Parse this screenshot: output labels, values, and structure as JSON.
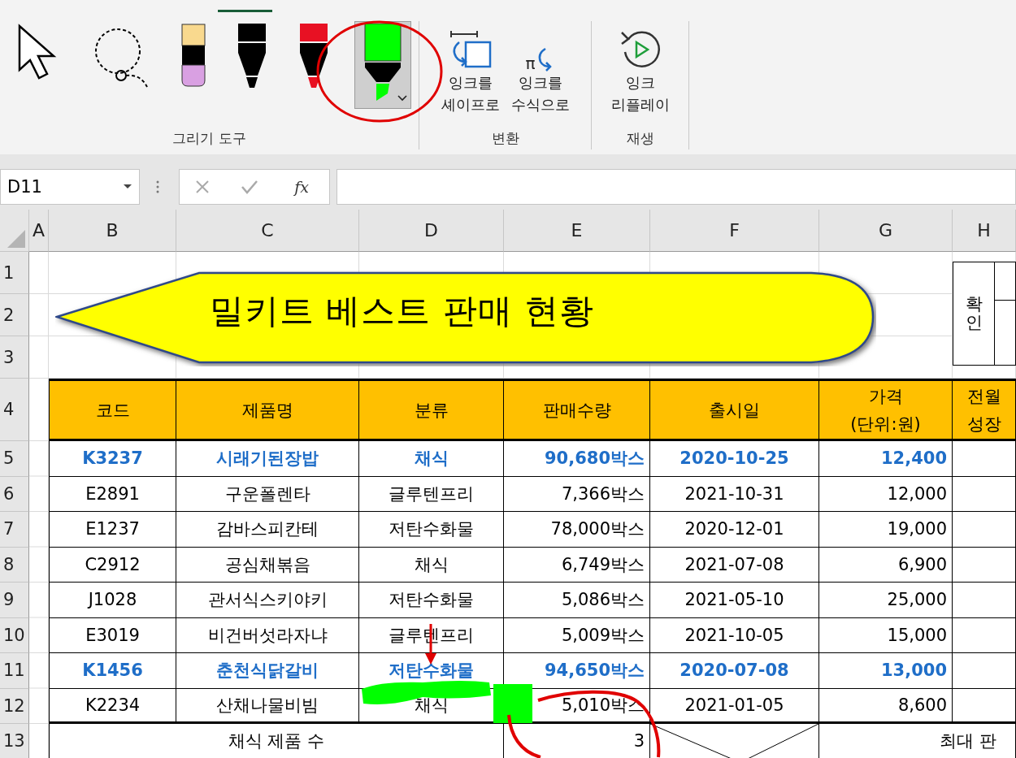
{
  "ribbon": {
    "groups": [
      {
        "label": "그리기 도구",
        "tools": [
          {
            "kind": "select",
            "selected": false
          },
          {
            "kind": "lasso",
            "selected": false
          },
          {
            "kind": "eraser",
            "selected": false
          },
          {
            "kind": "pen",
            "color": "#000000",
            "selected": false
          },
          {
            "kind": "pen",
            "color": "#e81123",
            "selected": false
          },
          {
            "kind": "highlighter",
            "color": "#00ff00",
            "selected": true
          }
        ]
      },
      {
        "label": "변환",
        "buttons": [
          {
            "kind": "shape",
            "lines": [
              "잉크를",
              "셰이프로"
            ]
          },
          {
            "kind": "math",
            "symbol": "π",
            "lines": [
              "잉크를",
              "수식으로"
            ]
          }
        ]
      },
      {
        "label": "재생",
        "buttons": [
          {
            "kind": "replay",
            "lines": [
              "잉크",
              "리플레이"
            ]
          }
        ]
      }
    ]
  },
  "formula_bar": {
    "name_box": "D11",
    "function_button": "fx"
  },
  "columns": [
    "A",
    "B",
    "C",
    "D",
    "E",
    "F",
    "G",
    "H"
  ],
  "row_headers": [
    "1",
    "2",
    "3",
    "4",
    "5",
    "6",
    "7",
    "8",
    "9",
    "10",
    "11",
    "12",
    "13"
  ],
  "banner": {
    "title": "밀키트 베스트 판매 현황"
  },
  "approval": {
    "label": "확인"
  },
  "table": {
    "headers": [
      [
        "코드"
      ],
      [
        "제품명"
      ],
      [
        "분류"
      ],
      [
        "판매수량"
      ],
      [
        "출시일"
      ],
      [
        "가격",
        "(단위:원)"
      ],
      [
        "전월",
        "성장"
      ]
    ],
    "rows": [
      {
        "highlight": true,
        "cells": [
          "K3237",
          "시래기된장밥",
          "채식",
          "90,680박스",
          "2020-10-25",
          "12,400"
        ]
      },
      {
        "highlight": false,
        "cells": [
          "E2891",
          "구운폴렌타",
          "글루텐프리",
          "7,366박스",
          "2021-10-31",
          "12,000"
        ]
      },
      {
        "highlight": false,
        "cells": [
          "E1237",
          "감바스피칸테",
          "저탄수화물",
          "78,000박스",
          "2020-12-01",
          "19,000"
        ]
      },
      {
        "highlight": false,
        "cells": [
          "C2912",
          "공심채볶음",
          "채식",
          "6,749박스",
          "2021-07-08",
          "6,900"
        ]
      },
      {
        "highlight": false,
        "cells": [
          "J1028",
          "관서식스키야키",
          "저탄수화물",
          "5,086박스",
          "2021-05-10",
          "25,000"
        ]
      },
      {
        "highlight": false,
        "cells": [
          "E3019",
          "비건버섯라자냐",
          "글루텐프리",
          "5,009박스",
          "2021-10-05",
          "15,000"
        ]
      },
      {
        "highlight": true,
        "cells": [
          "K1456",
          "춘천식닭갈비",
          "저탄수화물",
          "94,650박스",
          "2020-07-08",
          "13,000"
        ]
      },
      {
        "highlight": false,
        "cells": [
          "K2234",
          "산채나물비빔",
          "채식",
          "5,010박스",
          "2021-01-05",
          "8,600"
        ]
      }
    ],
    "summary": {
      "label": "채식 제품 수",
      "value": "3",
      "next_label": "최대 판"
    }
  }
}
